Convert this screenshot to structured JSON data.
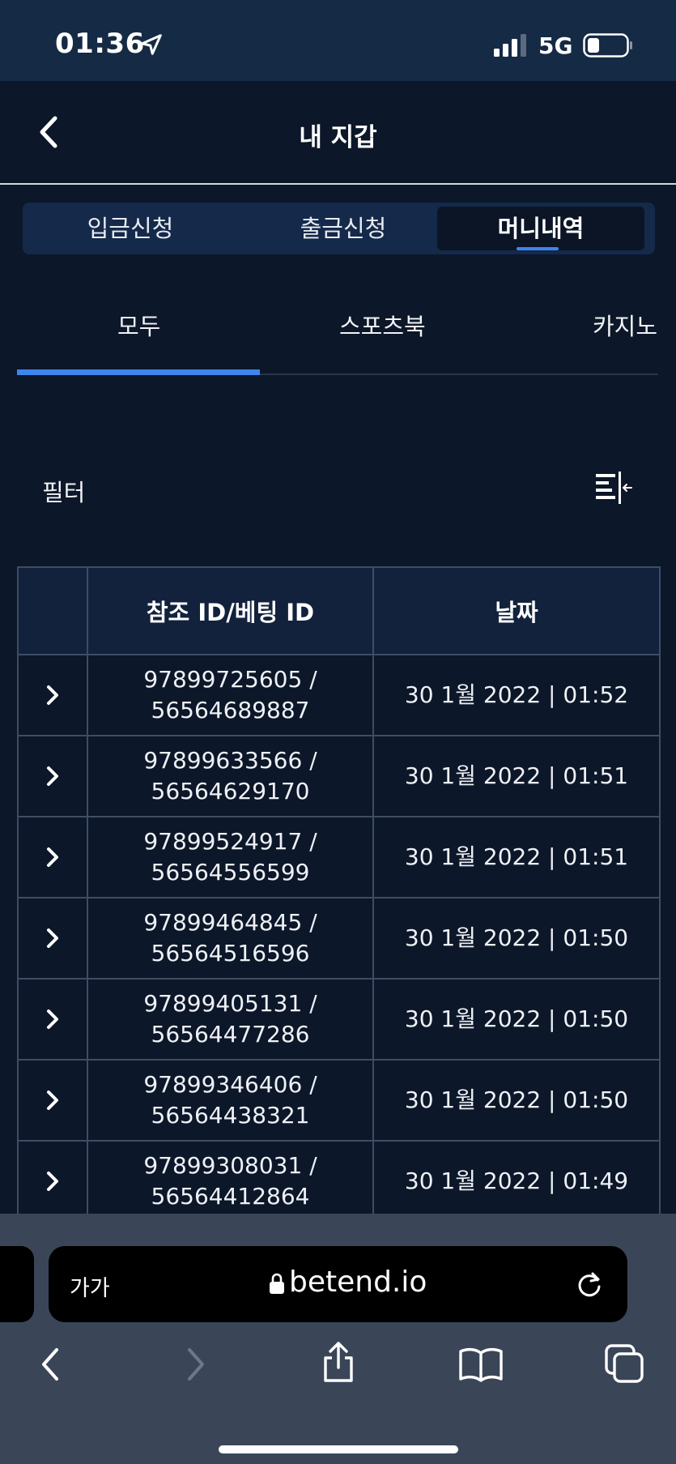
{
  "status_bar": {
    "time": "01:36",
    "network": "5G"
  },
  "header": {
    "title": "내 지갑"
  },
  "segment_tabs": [
    {
      "label": "입금신청",
      "active": false
    },
    {
      "label": "출금신청",
      "active": false
    },
    {
      "label": "머니내역",
      "active": true
    }
  ],
  "sub_tabs": [
    {
      "label": "모두",
      "active": true
    },
    {
      "label": "스포츠북",
      "active": false
    },
    {
      "label": "카지노",
      "active": false
    }
  ],
  "filter": {
    "label": "필터"
  },
  "table": {
    "headers": {
      "reference": "참조 ID/베팅 ID",
      "date": "날짜"
    },
    "rows": [
      {
        "ref_id": "97899725605 /",
        "bet_id": "56564689887",
        "date": "30 1월 2022 | 01:52"
      },
      {
        "ref_id": "97899633566 /",
        "bet_id": "56564629170",
        "date": "30 1월 2022 | 01:51"
      },
      {
        "ref_id": "97899524917 /",
        "bet_id": "56564556599",
        "date": "30 1월 2022 | 01:51"
      },
      {
        "ref_id": "97899464845 /",
        "bet_id": "56564516596",
        "date": "30 1월 2022 | 01:50"
      },
      {
        "ref_id": "97899405131 /",
        "bet_id": "56564477286",
        "date": "30 1월 2022 | 01:50"
      },
      {
        "ref_id": "97899346406 /",
        "bet_id": "56564438321",
        "date": "30 1월 2022 | 01:50"
      },
      {
        "ref_id": "97899308031 /",
        "bet_id": "56564412864",
        "date": "30 1월 2022 | 01:49"
      }
    ]
  },
  "browser": {
    "text_size_label": "가가",
    "url": "betend.io"
  },
  "colors": {
    "background": "#0c1729",
    "accent": "#3d86f0",
    "status_bar": "#152a45",
    "table_header": "#12223d",
    "browser_bar": "#3a4657"
  },
  "icons": {
    "back": "chevron-left-icon",
    "location": "location-arrow-icon",
    "filter": "filter-collapse-icon",
    "row_expand": "chevron-right-icon",
    "lock": "lock-icon",
    "reload": "reload-icon",
    "share": "share-icon",
    "bookmarks": "book-icon",
    "tabs": "tabs-icon"
  }
}
